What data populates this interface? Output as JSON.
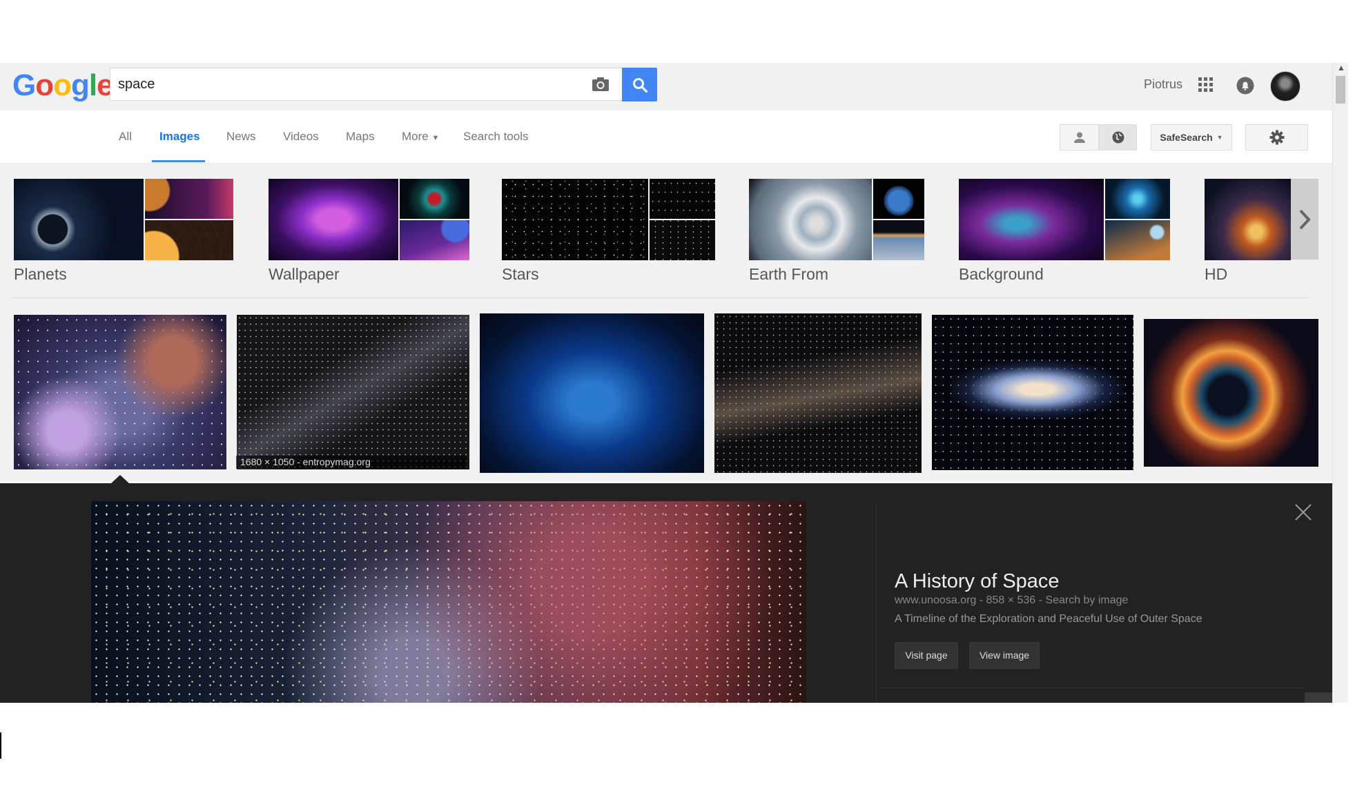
{
  "header": {
    "logo_text": "Google",
    "search_value": "space",
    "user_name": "Piotrus",
    "icons": [
      "camera-icon",
      "search-icon",
      "apps-grid-icon",
      "notifications-icon",
      "avatar"
    ]
  },
  "nav": {
    "tabs": [
      "All",
      "Images",
      "News",
      "Videos",
      "Maps",
      "More",
      "Search tools"
    ],
    "active_tab": "Images",
    "safesearch_label": "SafeSearch",
    "icons": [
      "person-icon",
      "globe-icon",
      "gear-icon",
      "chevron-down-icon"
    ]
  },
  "categories": {
    "items": [
      "Planets",
      "Wallpaper",
      "Stars",
      "Earth From",
      "Background",
      "HD"
    ],
    "next_icon": "chevron-right-icon"
  },
  "results": {
    "hover_caption": "1680 × 1050 - entropymag.org"
  },
  "preview": {
    "title": "A History of Space",
    "domain": "www.unoosa.org",
    "dimensions": "858 × 536",
    "search_by_image": "Search by image",
    "separator": "-",
    "description": "A Timeline of the Exploration and Peaceful Use of Outer Space",
    "visit_label": "Visit page",
    "view_label": "View image",
    "close_icon": "close-icon"
  },
  "colors": {
    "accent": "#4285f4",
    "panel_bg": "#222222",
    "header_bg": "#f1f1f1"
  }
}
